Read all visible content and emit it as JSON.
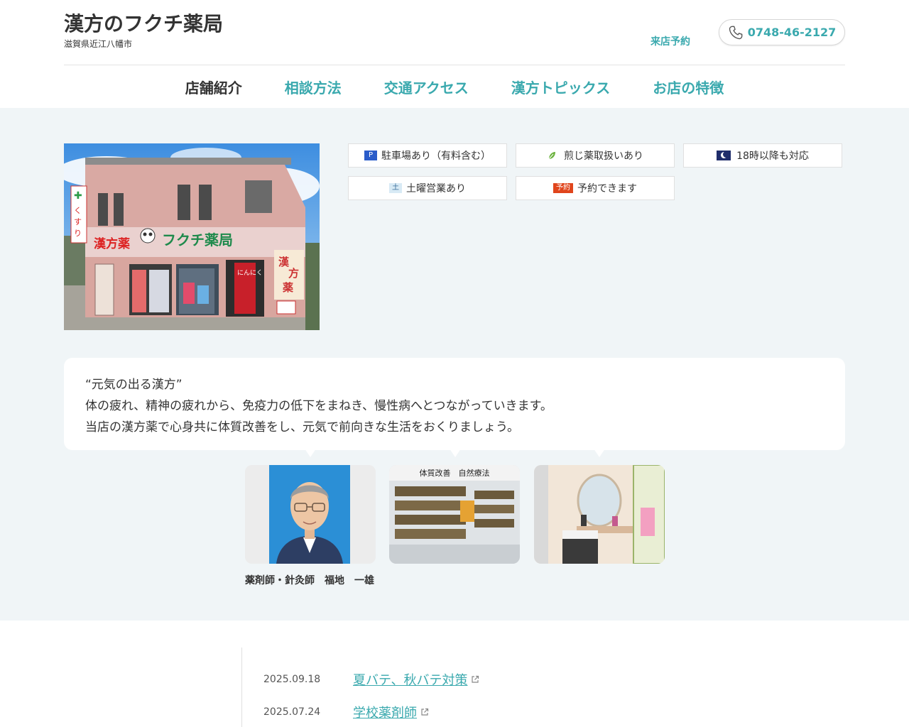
{
  "header": {
    "title": "漢方のフクチ薬局",
    "subtitle": "滋賀県近江八幡市",
    "reserve": "来店予約",
    "phone": "0748-46-2127"
  },
  "nav": {
    "items": [
      "店舗紹介",
      "相談方法",
      "交通アクセス",
      "漢方トピックス",
      "お店の特徴"
    ],
    "active_index": 0
  },
  "features": [
    {
      "badge": "P",
      "badge_color": "#2a5cc9",
      "label": "駐車場あり（有料含む）"
    },
    {
      "badge": "leaf",
      "badge_color": "#6cb33f",
      "label": "煎じ薬取扱いあり"
    },
    {
      "badge": "moon",
      "badge_color": "#1f2d6b",
      "label": "18時以降も対応"
    },
    {
      "badge": "土",
      "badge_color": "#d8eaf5",
      "label": "土曜営業あり"
    },
    {
      "badge": "予約",
      "badge_color": "#e0451c",
      "label": "予約できます"
    }
  ],
  "intro": {
    "line1": "“元気の出る漢方”",
    "line2": "体の疲れ、精神の疲れから、免疫力の低下をまねき、慢性病へとつながっていきます。",
    "line3": "当店の漢方薬で心身共に体質改善をし、元気で前向きな生活をおくりましょう。"
  },
  "storefront": {
    "sign_left": "漢方薬",
    "sign_main": "フクチ薬局",
    "sign_side": "くすり",
    "sign_right": "漢方薬"
  },
  "staff": {
    "caption": "薬剤師・針灸師　福地　一雄"
  },
  "interior": {
    "shelf_sign": "体質改善　自然療法"
  },
  "news": [
    {
      "date": "2025.09.18",
      "title": "夏バテ、秋バテ対策"
    },
    {
      "date": "2025.07.24",
      "title": "学校薬剤師"
    }
  ],
  "colors": {
    "accent": "#3aa9ae",
    "background": "#f0f5f7"
  }
}
